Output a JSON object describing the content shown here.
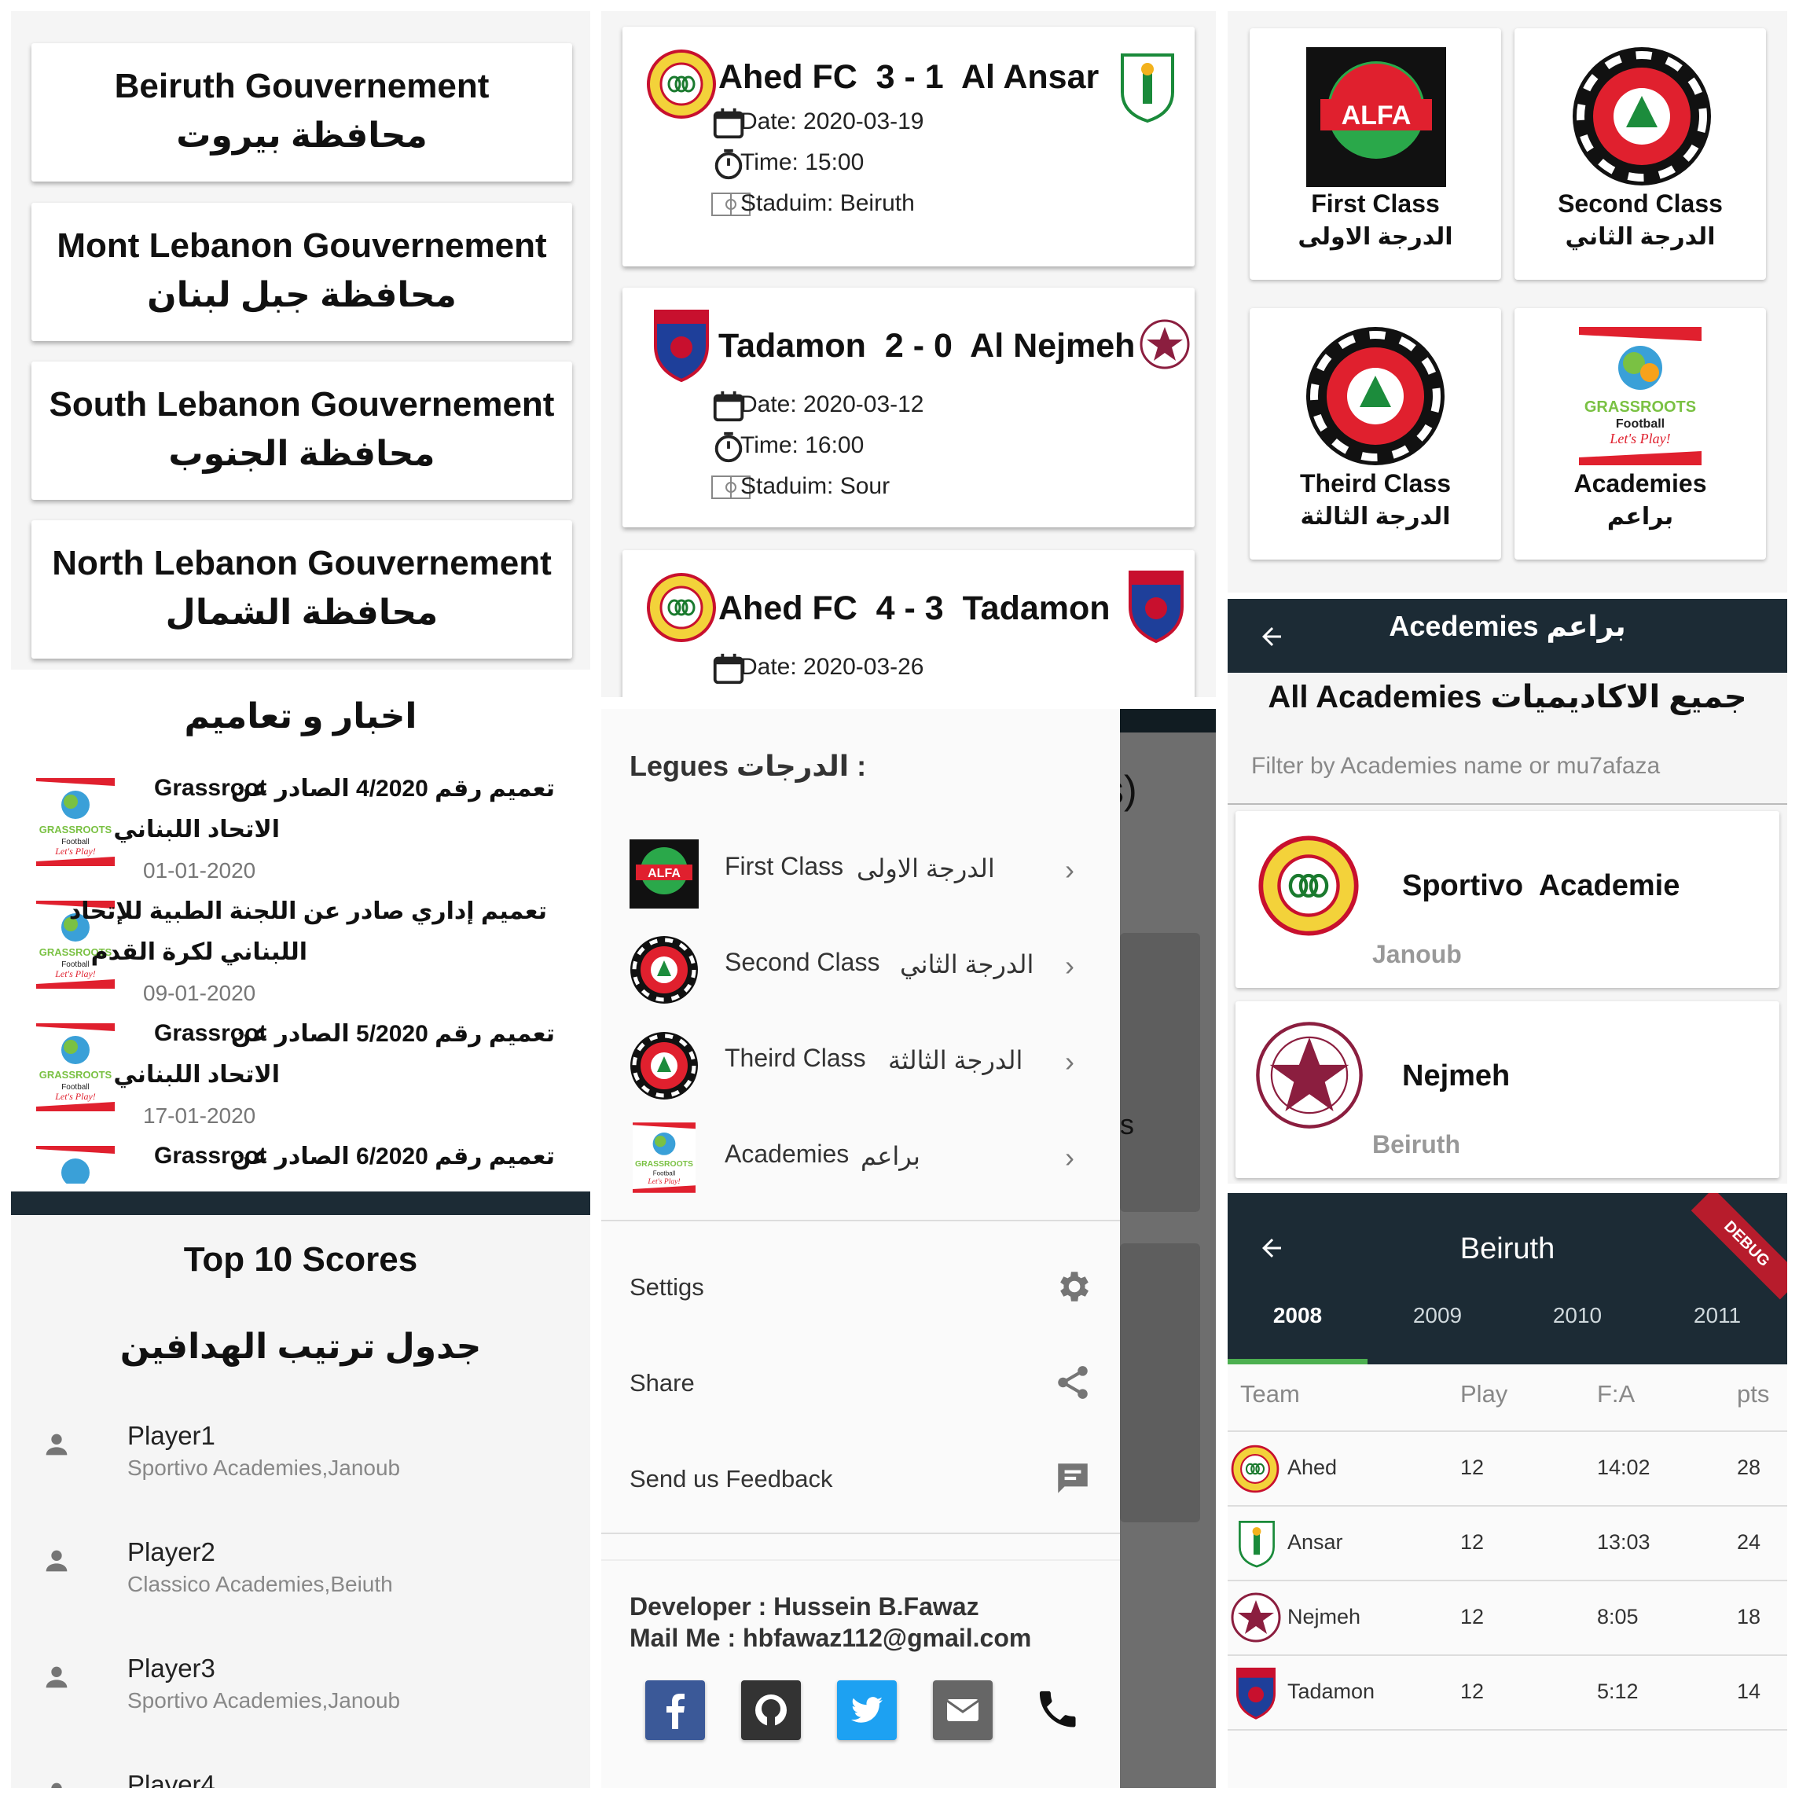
{
  "governorates": [
    {
      "en": "Beiruth Gouvernement",
      "ar": "محافظة بيروت"
    },
    {
      "en": "Mont Lebanon Gouvernement",
      "ar": "محافظة جبل لبنان"
    },
    {
      "en": "South Lebanon Gouvernement",
      "ar": "محافظة الجنوب"
    },
    {
      "en": "North Lebanon Gouvernement",
      "ar": "محافظة الشمال"
    }
  ],
  "matches": [
    {
      "teams": "Ahed FC  3 - 1  Al Ansar",
      "date": "Date: 2020-03-19",
      "time": "Time: 15:00",
      "stadium": "Staduim: Beiruth"
    },
    {
      "teams": "Tadamon  2 - 0  Al Nejmeh",
      "date": "Date: 2020-03-12",
      "time": "Time: 16:00",
      "stadium": "Staduim: Sour"
    },
    {
      "teams": "Ahed FC  4 - 3  Tadamon",
      "date": "Date: 2020-03-26"
    }
  ],
  "league_cards": [
    {
      "en": "First Class",
      "ar": "الدرجة الاولى"
    },
    {
      "en": "Second Class",
      "ar": "الدرجة الثاني"
    },
    {
      "en": "Theird Class",
      "ar": "الدرجة الثالثة"
    },
    {
      "en": "Academies",
      "ar": "براعم"
    }
  ],
  "news": {
    "title": "اخبار و تعاميم",
    "items": [
      {
        "line1": "تعميم رقم 4/2020 الصادر عن",
        "tag": "Grassroot",
        "line2": "الاتحاد اللبناني",
        "date": "01-01-2020"
      },
      {
        "line1": "تعميم إداري صادر عن اللجنة الطبية للإتحاد",
        "tag": "",
        "line2": "اللبناني لكرة القدم",
        "date": "09-01-2020"
      },
      {
        "line1": "تعميم رقم 5/2020 الصادر عن",
        "tag": "Grassroot",
        "line2": "الاتحاد اللبناني",
        "date": "17-01-2020"
      },
      {
        "line1": "تعميم رقم 6/2020 الصادر عن",
        "tag": "Grassroot",
        "line2": "",
        "date": ""
      }
    ]
  },
  "top10": {
    "title": "Top 10 Scores",
    "subtitle": "جدول ترتيب الهدافين",
    "players": [
      {
        "name": "Player1",
        "sub": "Sportivo Academies,Janoub"
      },
      {
        "name": "Player2",
        "sub": "Classico Academies,Beiuth"
      },
      {
        "name": "Player3",
        "sub": "Sportivo Academies,Janoub"
      },
      {
        "name": "Player4",
        "sub": ""
      }
    ]
  },
  "drawer": {
    "header": "Legues الدرجات :",
    "leagues": [
      {
        "en": "First Class",
        "ar": "الدرجة الاولى"
      },
      {
        "en": "Second Class",
        "ar": "الدرجة الثاني"
      },
      {
        "en": "Theird Class",
        "ar": "الدرجة الثالثة"
      },
      {
        "en": "Academies",
        "ar": "براعم"
      }
    ],
    "options": [
      "Settigs",
      "Share",
      "Send us Feedback"
    ],
    "developer": "Developer : Hussein B.Fawaz",
    "mail": "Mail Me : hbfawaz112@gmail.com",
    "bg_fragments": [
      "s)",
      "s"
    ],
    "social": [
      "facebook-icon",
      "github-icon",
      "twitter-icon",
      "mail-icon",
      "phone-icon"
    ]
  },
  "academies": {
    "appbar_title": "Acedemies  براعم",
    "heading": "All Academies  جميع الاكاديميات",
    "filter_placeholder": "Filter by Academies name  or mu7afaza",
    "list": [
      {
        "name": "Sportivo  Academie",
        "region": "Janoub"
      },
      {
        "name": "Nejmeh",
        "region": "Beiruth"
      }
    ]
  },
  "beiruth": {
    "appbar_title": "Beiruth",
    "debug_banner": "DEBUG",
    "tabs": [
      "2008",
      "2009",
      "2010",
      "2011"
    ],
    "headers": [
      "Team",
      "Play",
      "F:A",
      "pts"
    ],
    "rows": [
      {
        "team": "Ahed",
        "play": "12",
        "fa": "14:02",
        "pts": "28"
      },
      {
        "team": "Ansar",
        "play": "12",
        "fa": "13:03",
        "pts": "24"
      },
      {
        "team": "Nejmeh",
        "play": "12",
        "fa": "8:05",
        "pts": "18"
      },
      {
        "team": "Tadamon",
        "play": "12",
        "fa": "5:12",
        "pts": "14"
      }
    ]
  },
  "colors": {
    "appbar": "#1c2b35",
    "accent": "#4caf50",
    "lebanon_red": "#e0202e",
    "cedar_green": "#1c8c3c",
    "facebook": "#3b5998",
    "twitter": "#1da1f2",
    "github": "#333333"
  }
}
